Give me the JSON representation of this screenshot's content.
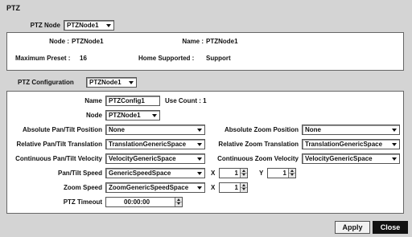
{
  "title": "PTZ",
  "ptz_node": {
    "label": "PTZ Node",
    "value": "PTZNode1",
    "node_label": "Node :",
    "node_value": "PTZNode1",
    "name_label": "Name :",
    "name_value": "PTZNode1",
    "max_preset_label": "Maximum Preset :",
    "max_preset_value": "16",
    "home_label": "Home Supported :",
    "home_value": "Support"
  },
  "config": {
    "label": "PTZ Configuration",
    "value": "PTZNode1",
    "name_label": "Name",
    "name_value": "PTZConfig1",
    "use_count": "Use Count : 1",
    "node_label": "Node",
    "node_value": "PTZNode1",
    "abs_pt_label": "Absolute Pan/Tilt Position",
    "abs_pt_value": "None",
    "abs_zoom_label": "Absolute Zoom Position",
    "abs_zoom_value": "None",
    "rel_pt_label": "Relative Pan/Tilt Translation",
    "rel_pt_value": "TranslationGenericSpace",
    "rel_zoom_label": "Relative Zoom Translation",
    "rel_zoom_value": "TranslationGenericSpace",
    "cont_pt_label": "Continuous Pan/Tilt Velocity",
    "cont_pt_value": "VelocityGenericSpace",
    "cont_zoom_label": "Continuous Zoom Velocity",
    "cont_zoom_value": "VelocityGenericSpace",
    "pt_speed_label": "Pan/Tilt Speed",
    "pt_speed_value": "GenericSpeedSpace",
    "pt_x_label": "X",
    "pt_x_value": "1",
    "pt_y_label": "Y",
    "pt_y_value": "1",
    "zoom_speed_label": "Zoom Speed",
    "zoom_speed_value": "ZoomGenericSpeedSpace",
    "zoom_x_label": "X",
    "zoom_x_value": "1",
    "timeout_label": "PTZ Timeout",
    "timeout_value": "00:00:00"
  },
  "buttons": {
    "apply": "Apply",
    "close": "Close"
  },
  "colors": {
    "background": "#d4d4d4",
    "panel": "#ffffff",
    "close_button": "#111111"
  }
}
